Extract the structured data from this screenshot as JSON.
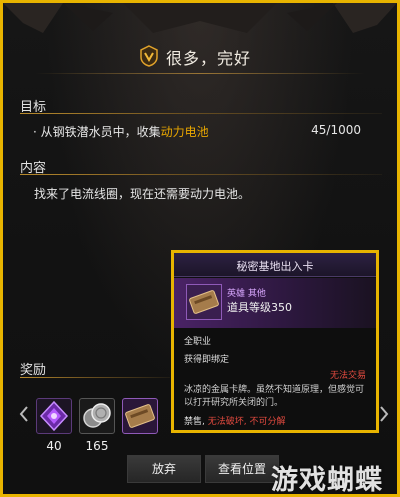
{
  "quest": {
    "title": "很多，完好",
    "objective_label": "目标",
    "objective_prefix": "· 从钢铁潜水员中，收集",
    "objective_item": "动力电池",
    "objective_progress": "45/1000",
    "content_label": "内容",
    "content_text": "找来了电流线圈，现在还需要动力电池。",
    "reward_label": "奖励"
  },
  "rewards": [
    {
      "icon": "purple-crystal-icon",
      "count": "40"
    },
    {
      "icon": "silver-coins-icon",
      "count": "165"
    },
    {
      "icon": "access-card-icon",
      "count": ""
    }
  ],
  "buttons": {
    "abandon": "放弃",
    "view_location": "查看位置"
  },
  "tooltip": {
    "title": "秘密基地出入卡",
    "grade": "英雄 其他",
    "item_level": "道具等级350",
    "class": "全职业",
    "bind": "获得即绑定",
    "trade": "无法交易",
    "description": "冰凉的金属卡牌。虽然不知道原理，但感觉可以打开研究所关闭的门。",
    "restriction_prefix": "禁售, ",
    "restriction_suffix": "无法破坏, 不可分解"
  },
  "watermark": "游戏蝴蝶",
  "colors": {
    "highlight_border": "#e8b400",
    "quest_item_highlight": "#e8a600",
    "hero_grade": "#d9a8ff",
    "warning_red": "#e34a3f"
  }
}
